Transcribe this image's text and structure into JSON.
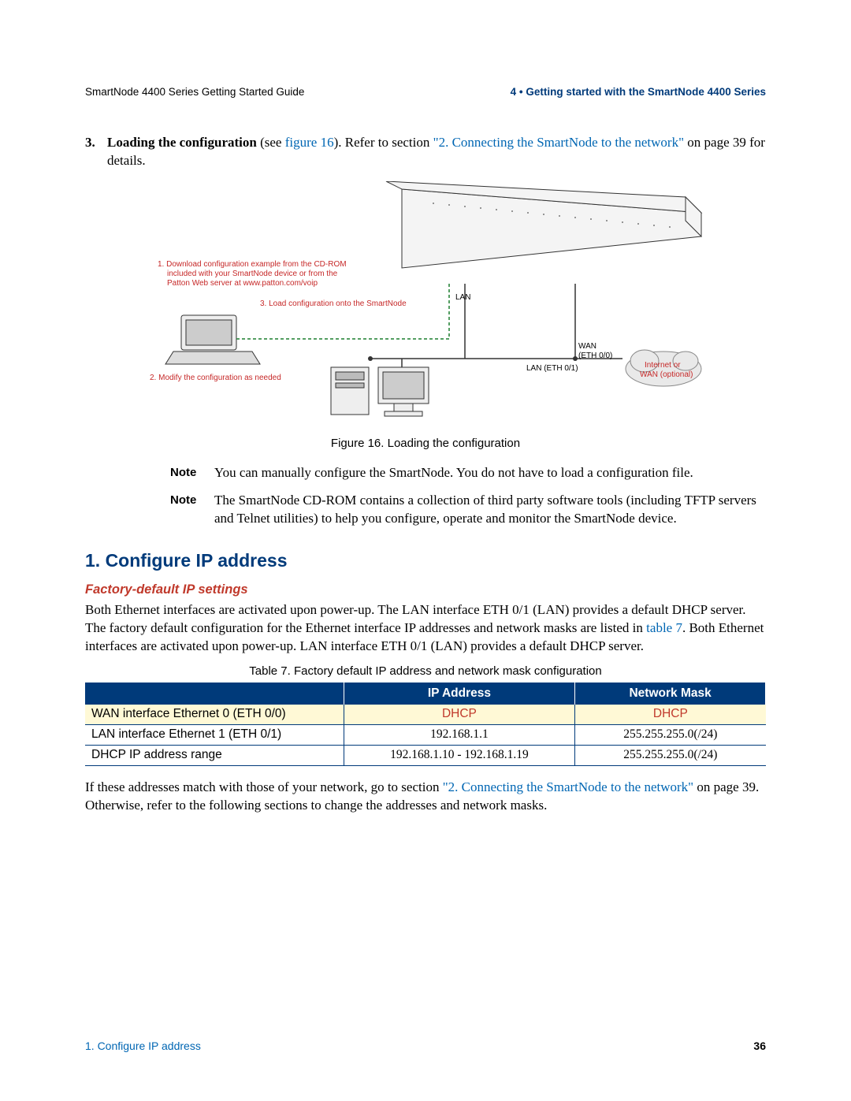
{
  "header": {
    "left": "SmartNode 4400 Series Getting Started Guide",
    "right": "4 • Getting started with the SmartNode 4400 Series"
  },
  "step": {
    "num": "3.",
    "lead_bold": "Loading the configuration",
    "lead_rest": " (see ",
    "fig_ref": "figure 16",
    "after_figref": "). Refer to section ",
    "link": "\"2. Connecting the SmartNode to the network\"",
    "tail": " on page 39 for details."
  },
  "figure": {
    "caption": "Figure 16. Loading the configuration",
    "callouts": {
      "c1_line1": "1.  Download configuration example from the CD-ROM",
      "c1_line2": "included with your SmartNode device or from the",
      "c1_line3": "Patton Web server at www.patton.com/voip",
      "c2": "2. Modify the configuration as needed",
      "c3": "3. Load configuration onto the SmartNode",
      "lan": "LAN",
      "lan_eth": "LAN (ETH 0/1)",
      "wan": "WAN",
      "wan_eth": "(ETH 0/0)",
      "cloud1": "Internet or",
      "cloud2": "WAN (optional)"
    }
  },
  "notes": {
    "label": "Note",
    "n1": "You can manually configure the SmartNode. You do not have to load a configuration file.",
    "n2": "The SmartNode CD-ROM contains a collection of third party software tools (including TFTP servers and Telnet utilities) to help you configure, operate and monitor the SmartNode device."
  },
  "section": {
    "h2": "1. Configure IP address",
    "h3": "Factory-default IP settings",
    "para_pre": "Both Ethernet interfaces are activated upon power-up. The LAN interface ETH 0/1 (LAN) provides a default DHCP server. The factory default configuration for the Ethernet interface IP addresses and network masks are listed in ",
    "para_link": "table 7",
    "para_post": ". Both Ethernet interfaces are activated upon power-up. LAN interface ETH 0/1 (LAN) provides a default DHCP server."
  },
  "table": {
    "caption": "Table 7. Factory default IP address and network mask configuration",
    "headers": {
      "blank": "",
      "ip": "IP Address",
      "mask": "Network Mask"
    },
    "rows": [
      {
        "label": "WAN interface Ethernet 0 (ETH 0/0)",
        "ip": "DHCP",
        "mask": "DHCP",
        "hl": true
      },
      {
        "label": "LAN interface Ethernet 1 (ETH 0/1)",
        "ip": "192.168.1.1",
        "mask": "255.255.255.0(/24)",
        "hl": false
      },
      {
        "label": "DHCP IP address range",
        "ip": "192.168.1.10 - 192.168.1.19",
        "mask": "255.255.255.0(/24)",
        "hl": false
      }
    ]
  },
  "closing": {
    "pre": "If these addresses match with those of your network, go to section ",
    "link": "\"2. Connecting the SmartNode to the network\"",
    "post": " on page 39. Otherwise, refer to the following sections to change the addresses and network masks."
  },
  "footer": {
    "left": "1. Configure IP address",
    "right": "36"
  }
}
